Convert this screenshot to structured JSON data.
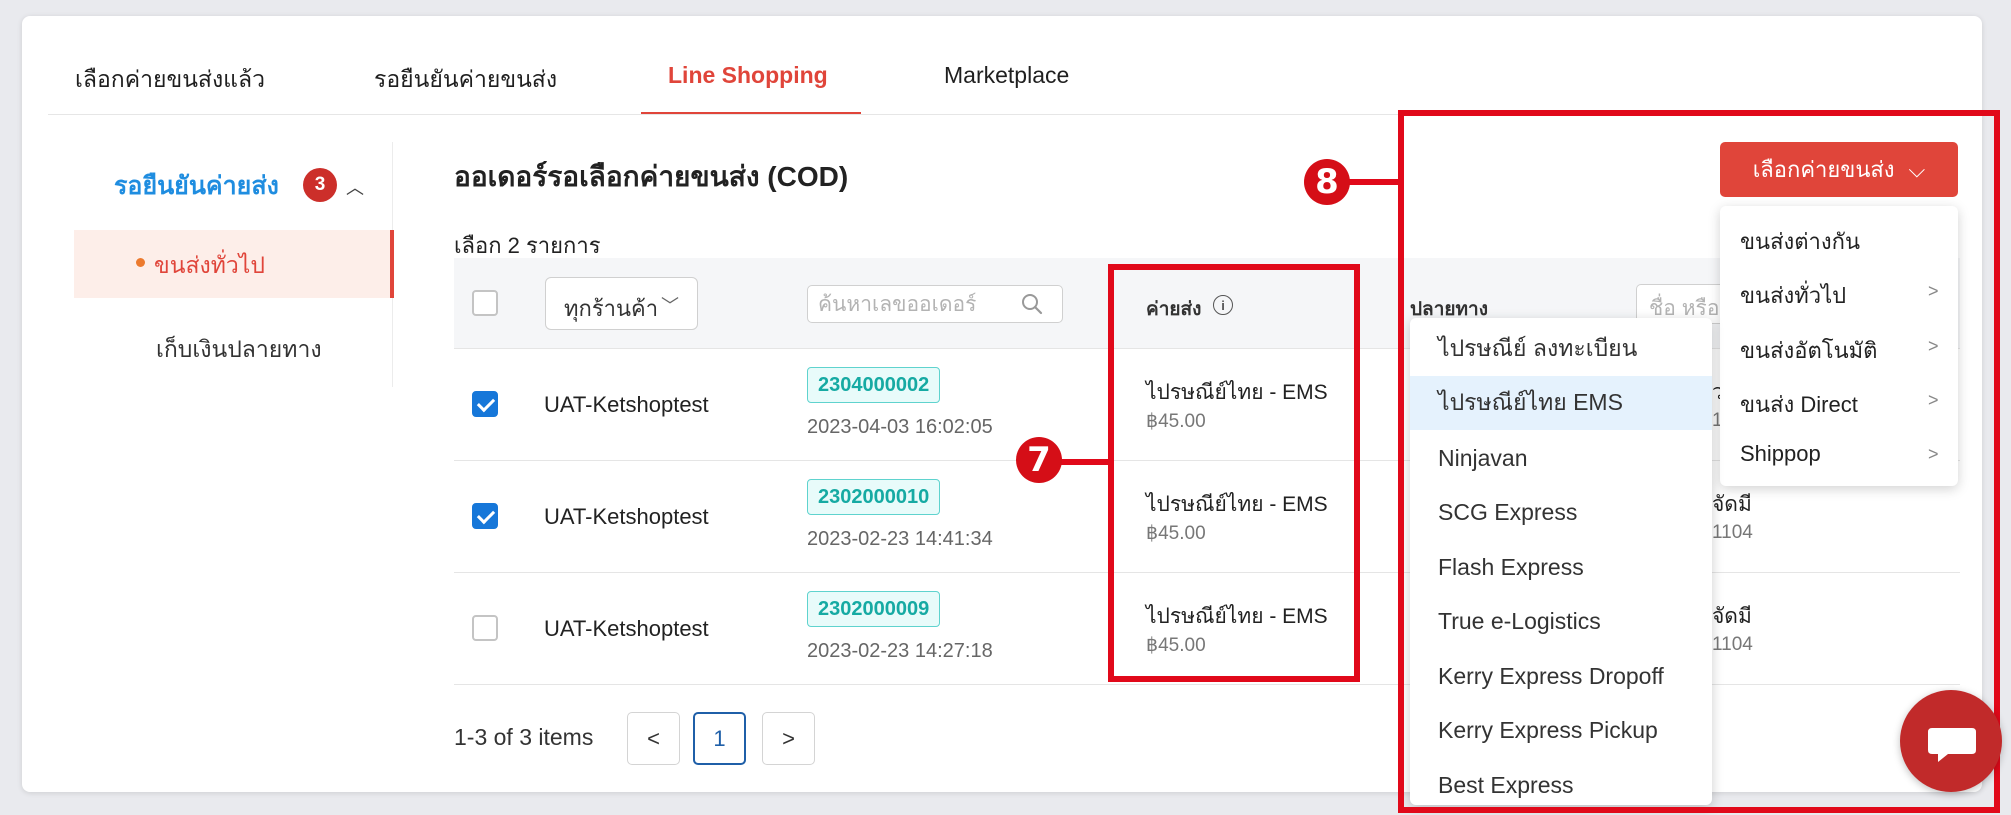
{
  "tabs": [
    {
      "label": "เลือกค่ายขนส่งแล้ว"
    },
    {
      "label": "รอยืนยันค่ายขนส่ง"
    },
    {
      "label": "Line Shopping"
    },
    {
      "label": "Marketplace"
    }
  ],
  "sidebar": {
    "title": "รอยืนยันค่ายส่ง",
    "badge": "3",
    "items": [
      {
        "label": "ขนส่งทั่วไป"
      },
      {
        "label": "เก็บเงินปลายทาง"
      }
    ]
  },
  "main": {
    "title": "ออเดอร์รอเลือกค่ายขนส่ง (COD)",
    "selected_count": "เลือก 2 รายการ",
    "store_filter": "ทุกร้านค้า",
    "search_placeholder": "ค้นหาเลขออเดอร์",
    "col_shipping": "ค่ายส่ง",
    "col_destination": "ปลายทาง",
    "dest_search_placeholder": "ชื่อ หรือ"
  },
  "rows": [
    {
      "checked": true,
      "store": "UAT-Ketshoptest",
      "order_no": "2304000002",
      "date": "2023-04-03 16:02:05",
      "carrier": "ไปรษณีย์ไทย - EMS",
      "price": "฿45.00",
      "dest_a": "",
      "dest_b": ""
    },
    {
      "checked": true,
      "store": "UAT-Ketshoptest",
      "order_no": "2302000010",
      "date": "2023-02-23 14:41:34",
      "carrier": "ไปรษณีย์ไทย - EMS",
      "price": "฿45.00",
      "dest_a": "จัดมี",
      "dest_b": "1104"
    },
    {
      "checked": false,
      "store": "UAT-Ketshoptest",
      "order_no": "2302000009",
      "date": "2023-02-23 14:27:18",
      "carrier": "ไปรษณีย์ไทย - EMS",
      "price": "฿45.00",
      "dest_a": "จัดมี",
      "dest_b": "1104"
    }
  ],
  "row1_dest_frag": "ว",
  "row1_dest_frag2": "1",
  "pagination": {
    "info": "1-3 of 3 items",
    "prev": "<",
    "current": "1",
    "next": ">"
  },
  "carrier_button": {
    "label": "เลือกค่ายขนส่ง",
    "chevron": "⌵"
  },
  "carrier_menu": [
    {
      "label": "ขนส่งต่างกัน",
      "arrow": ""
    },
    {
      "label": "ขนส่งทั่วไป",
      "arrow": ">"
    },
    {
      "label": "ขนส่งอัตโนมัติ",
      "arrow": ">"
    },
    {
      "label": "ขนส่ง Direct",
      "arrow": ">"
    },
    {
      "label": "Shippop",
      "arrow": ">"
    }
  ],
  "carrier_submenu": [
    {
      "label": "ไปรษณีย์ ลงทะเบียน"
    },
    {
      "label": "ไปรษณีย์ไทย EMS"
    },
    {
      "label": "Ninjavan"
    },
    {
      "label": "SCG Express"
    },
    {
      "label": "Flash Express"
    },
    {
      "label": "True e-Logistics"
    },
    {
      "label": "Kerry Express Dropoff"
    },
    {
      "label": "Kerry Express Pickup"
    },
    {
      "label": "Best Express"
    }
  ],
  "annotations": {
    "seven": "7",
    "eight": "8"
  },
  "colors": {
    "accent": "#e0453a",
    "link_blue": "#1f8de0",
    "annotation_red": "#e1091a",
    "order_teal": "#16aaa3"
  }
}
